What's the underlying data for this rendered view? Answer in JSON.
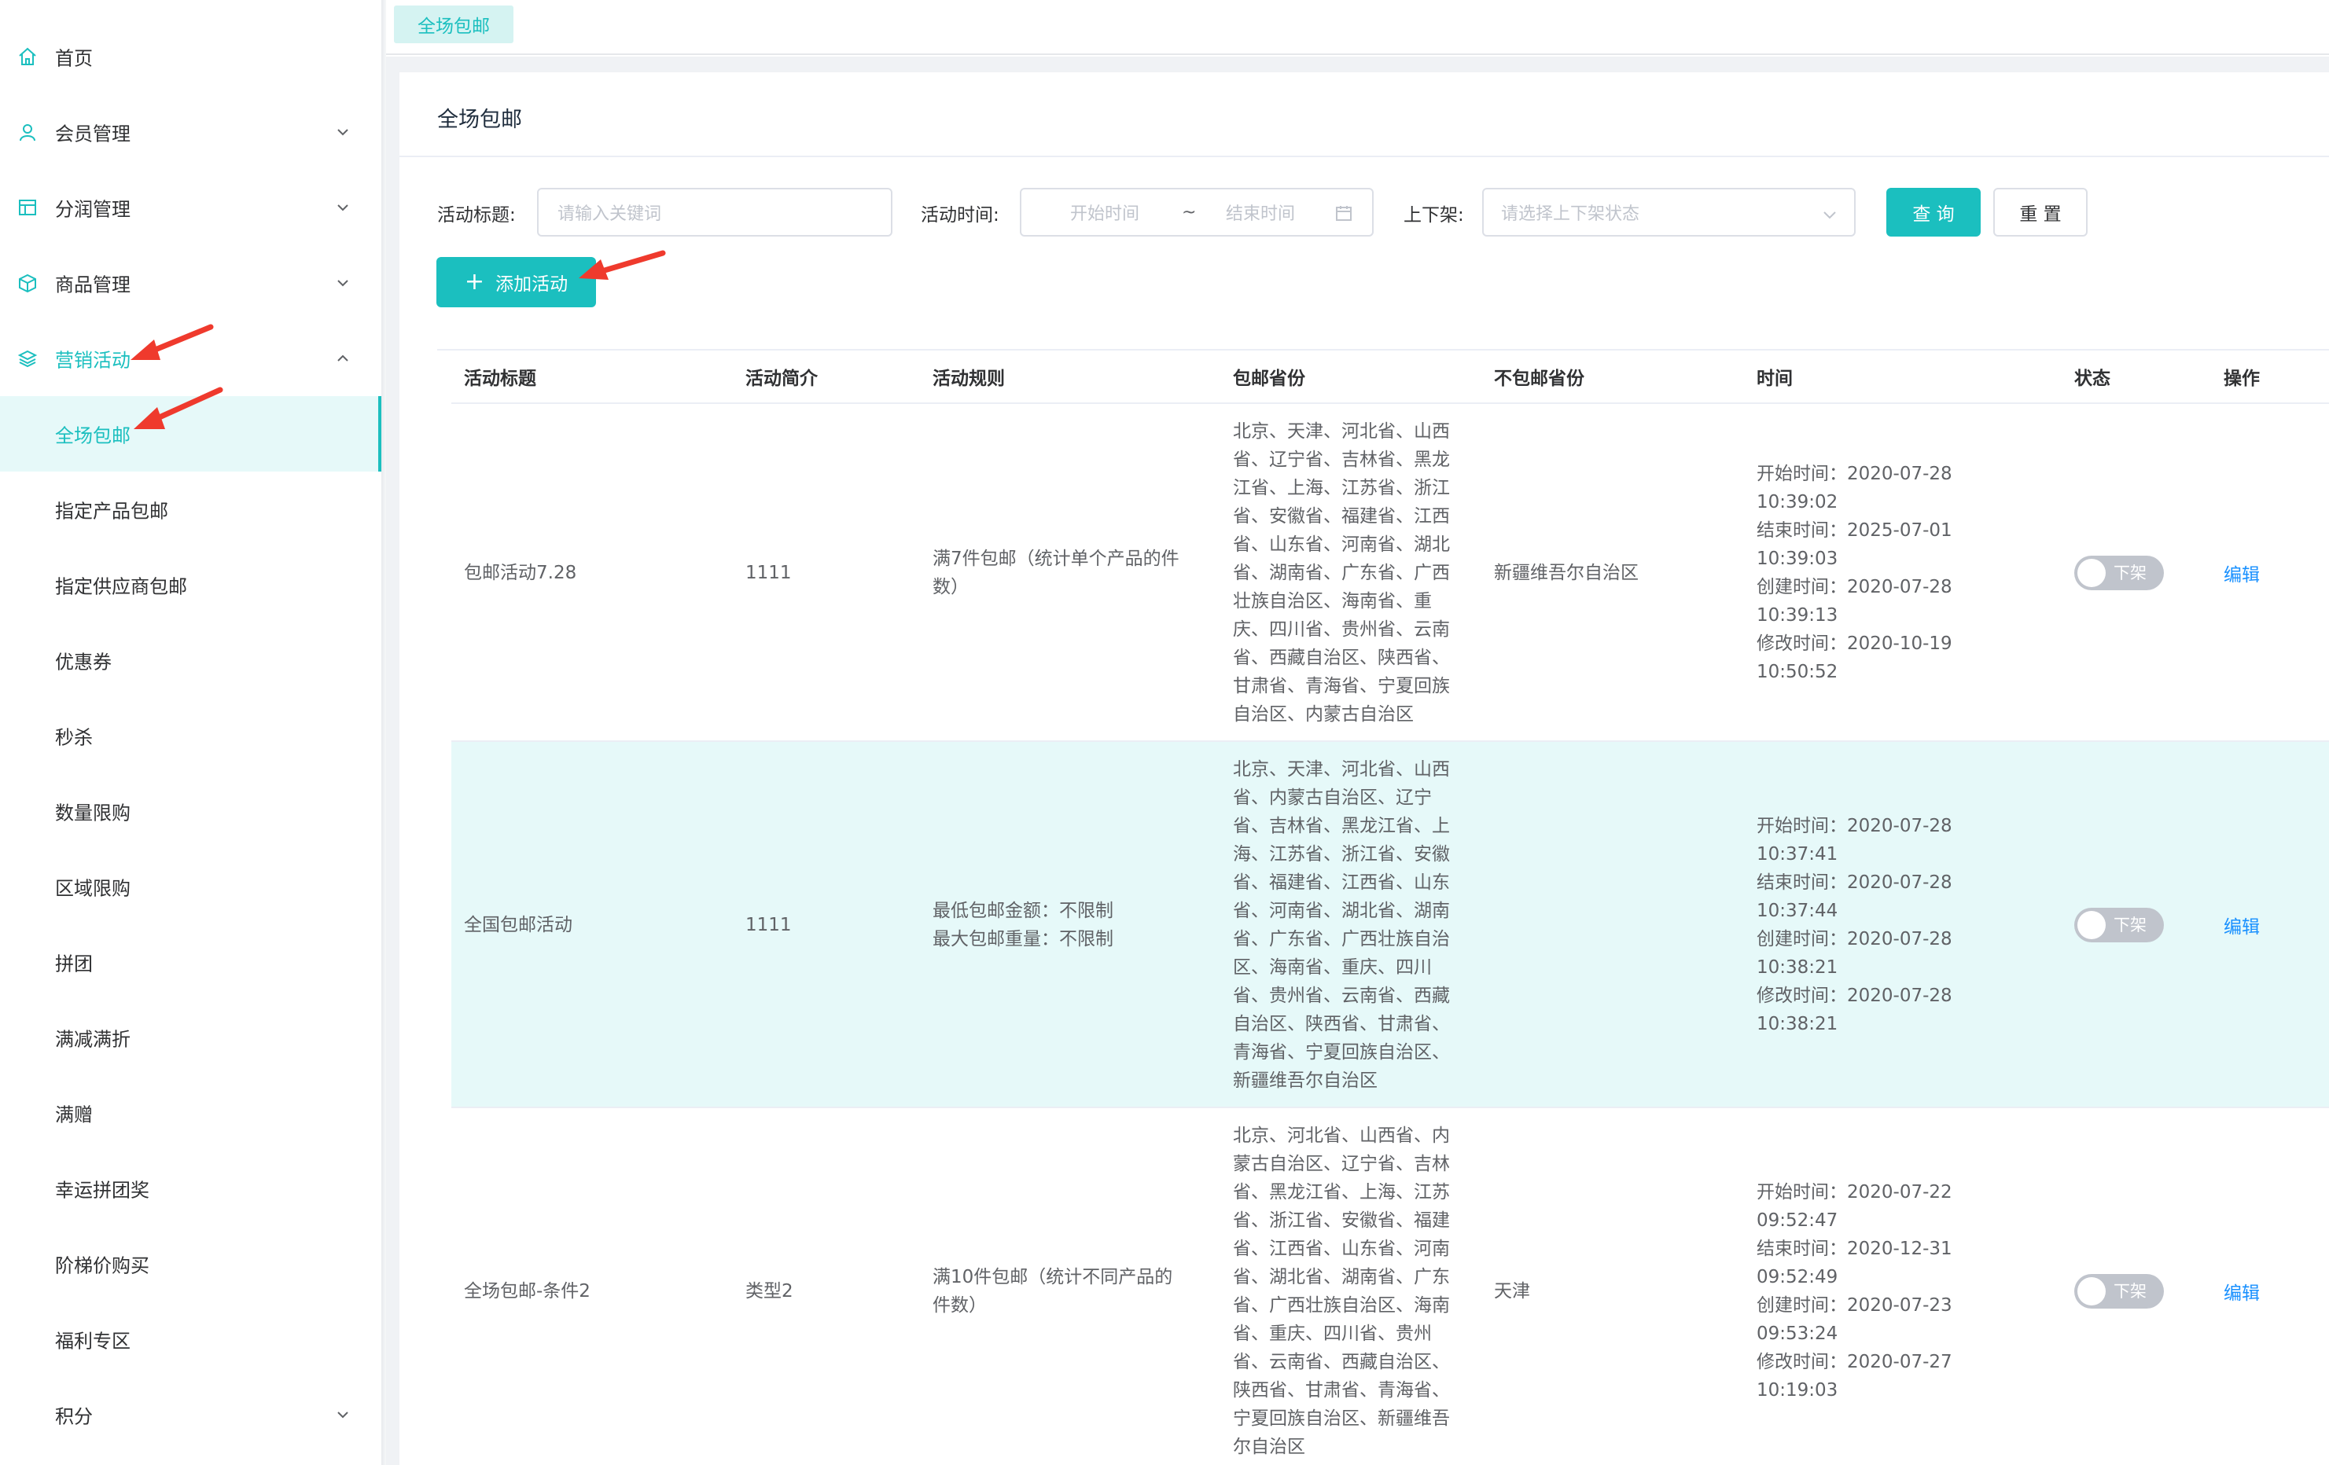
{
  "sidebar": {
    "items": [
      {
        "label": "首页"
      },
      {
        "label": "会员管理"
      },
      {
        "label": "分润管理"
      },
      {
        "label": "商品管理"
      },
      {
        "label": "营销活动"
      },
      {
        "label": "全场包邮"
      },
      {
        "label": "指定产品包邮"
      },
      {
        "label": "指定供应商包邮"
      },
      {
        "label": "优惠券"
      },
      {
        "label": "秒杀"
      },
      {
        "label": "数量限购"
      },
      {
        "label": "区域限购"
      },
      {
        "label": "拼团"
      },
      {
        "label": "满减满折"
      },
      {
        "label": "满赠"
      },
      {
        "label": "幸运拼团奖"
      },
      {
        "label": "阶梯价购买"
      },
      {
        "label": "福利专区"
      },
      {
        "label": "积分"
      }
    ]
  },
  "tags": {
    "active": "全场包邮"
  },
  "card": {
    "title": "全场包邮"
  },
  "filters": {
    "title_label": "活动标题:",
    "title_placeholder": "请输入关键词",
    "time_label": "活动时间:",
    "start_placeholder": "开始时间",
    "range_sep": "~",
    "end_placeholder": "结束时间",
    "status_label": "上下架:",
    "status_placeholder": "请选择上下架状态",
    "query_label": "查 询",
    "reset_label": "重 置",
    "add_label": "添加活动"
  },
  "table": {
    "columns": [
      "活动标题",
      "活动简介",
      "活动规则",
      "包邮省份",
      "不包邮省份",
      "时间",
      "状态",
      "操作"
    ],
    "rows": [
      {
        "title": "包邮活动7.28",
        "intro": "1111",
        "rules": [
          "满7件包邮（统计单个产品的件",
          "数）"
        ],
        "provinces": [
          "北京、天津、河北省、山西",
          "省、辽宁省、吉林省、黑龙",
          "江省、上海、江苏省、浙江",
          "省、安徽省、福建省、江西",
          "省、山东省、河南省、湖北",
          "省、湖南省、广东省、广西",
          "壮族自治区、海南省、重",
          "庆、四川省、贵州省、云南",
          "省、西藏自治区、陕西省、",
          "甘肃省、青海省、宁夏回族",
          "自治区、内蒙古自治区"
        ],
        "excluded": "新疆维吾尔自治区",
        "times": [
          "开始时间：2020-07-28",
          "10:39:02",
          "结束时间：2025-07-01",
          "10:39:03",
          "创建时间：2020-07-28",
          "10:39:13",
          "修改时间：2020-10-19",
          "10:50:52"
        ],
        "status": "下架",
        "action": "编辑"
      },
      {
        "title": "全国包邮活动",
        "intro": "1111",
        "rules": [
          "最低包邮金额：不限制",
          "最大包邮重量：不限制"
        ],
        "provinces": [
          "北京、天津、河北省、山西",
          "省、内蒙古自治区、辽宁",
          "省、吉林省、黑龙江省、上",
          "海、江苏省、浙江省、安徽",
          "省、福建省、江西省、山东",
          "省、河南省、湖北省、湖南",
          "省、广东省、广西壮族自治",
          "区、海南省、重庆、四川",
          "省、贵州省、云南省、西藏",
          "自治区、陕西省、甘肃省、",
          "青海省、宁夏回族自治区、",
          "新疆维吾尔自治区"
        ],
        "excluded": "",
        "times": [
          "开始时间：2020-07-28",
          "10:37:41",
          "结束时间：2020-07-28",
          "10:37:44",
          "创建时间：2020-07-28",
          "10:38:21",
          "修改时间：2020-07-28",
          "10:38:21"
        ],
        "status": "下架",
        "action": "编辑"
      },
      {
        "title": "全场包邮-条件2",
        "intro": "类型2",
        "rules": [
          "满10件包邮（统计不同产品的",
          "件数）"
        ],
        "provinces": [
          "北京、河北省、山西省、内",
          "蒙古自治区、辽宁省、吉林",
          "省、黑龙江省、上海、江苏",
          "省、浙江省、安徽省、福建",
          "省、江西省、山东省、河南",
          "省、湖北省、湖南省、广东",
          "省、广西壮族自治区、海南",
          "省、重庆、四川省、贵州",
          "省、云南省、西藏自治区、",
          "陕西省、甘肃省、青海省、",
          "宁夏回族自治区、新疆维吾",
          "尔自治区"
        ],
        "excluded": "天津",
        "times": [
          "开始时间：2020-07-22",
          "09:52:47",
          "结束时间：2020-12-31",
          "09:52:49",
          "创建时间：2020-07-23",
          "09:53:24",
          "修改时间：2020-07-27",
          "10:19:03"
        ],
        "status": "下架",
        "action": "编辑"
      }
    ]
  },
  "colors": {
    "primary": "#1bbfbf",
    "link": "#1890ff",
    "annotation_arrow": "#ef3a2d"
  }
}
